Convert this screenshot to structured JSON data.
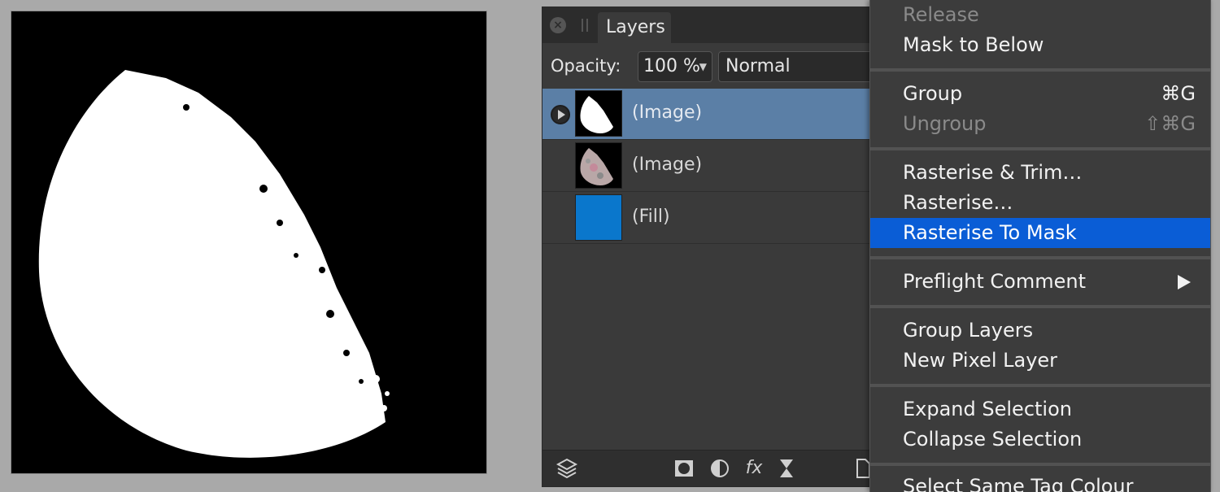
{
  "layers_panel": {
    "tab_label": "Layers",
    "opacity_label": "Opacity:",
    "opacity_value": "100 %",
    "blend_mode": "Normal",
    "layers": [
      {
        "name": "(Image)",
        "thumbnail": "moon-mask",
        "selected": true
      },
      {
        "name": "(Image)",
        "thumbnail": "moon-photo",
        "selected": false
      },
      {
        "name": "(Fill)",
        "thumbnail": "blue-fill",
        "selected": false
      }
    ],
    "bottom_icons": [
      "layers-icon",
      "mask-icon",
      "adjustment-icon",
      "fx-icon",
      "live-filter-icon",
      "page-icon"
    ]
  },
  "context_menu": {
    "release": "Release",
    "mask_to_below": "Mask to Below",
    "group": "Group",
    "group_shortcut": "⌘G",
    "ungroup": "Ungroup",
    "ungroup_shortcut": "⇧⌘G",
    "rasterise_trim": "Rasterise & Trim…",
    "rasterise": "Rasterise…",
    "rasterise_to_mask": "Rasterise To Mask",
    "preflight_comment": "Preflight Comment",
    "group_layers": "Group Layers",
    "new_pixel_layer": "New Pixel Layer",
    "expand_selection": "Expand Selection",
    "collapse_selection": "Collapse Selection",
    "select_same_tag_colour": "Select Same Tag Colour"
  },
  "colors": {
    "menu_highlight": "#0a5dd6",
    "selected_layer": "#5b7fa6",
    "fill_thumbnail": "#0a77cc"
  }
}
